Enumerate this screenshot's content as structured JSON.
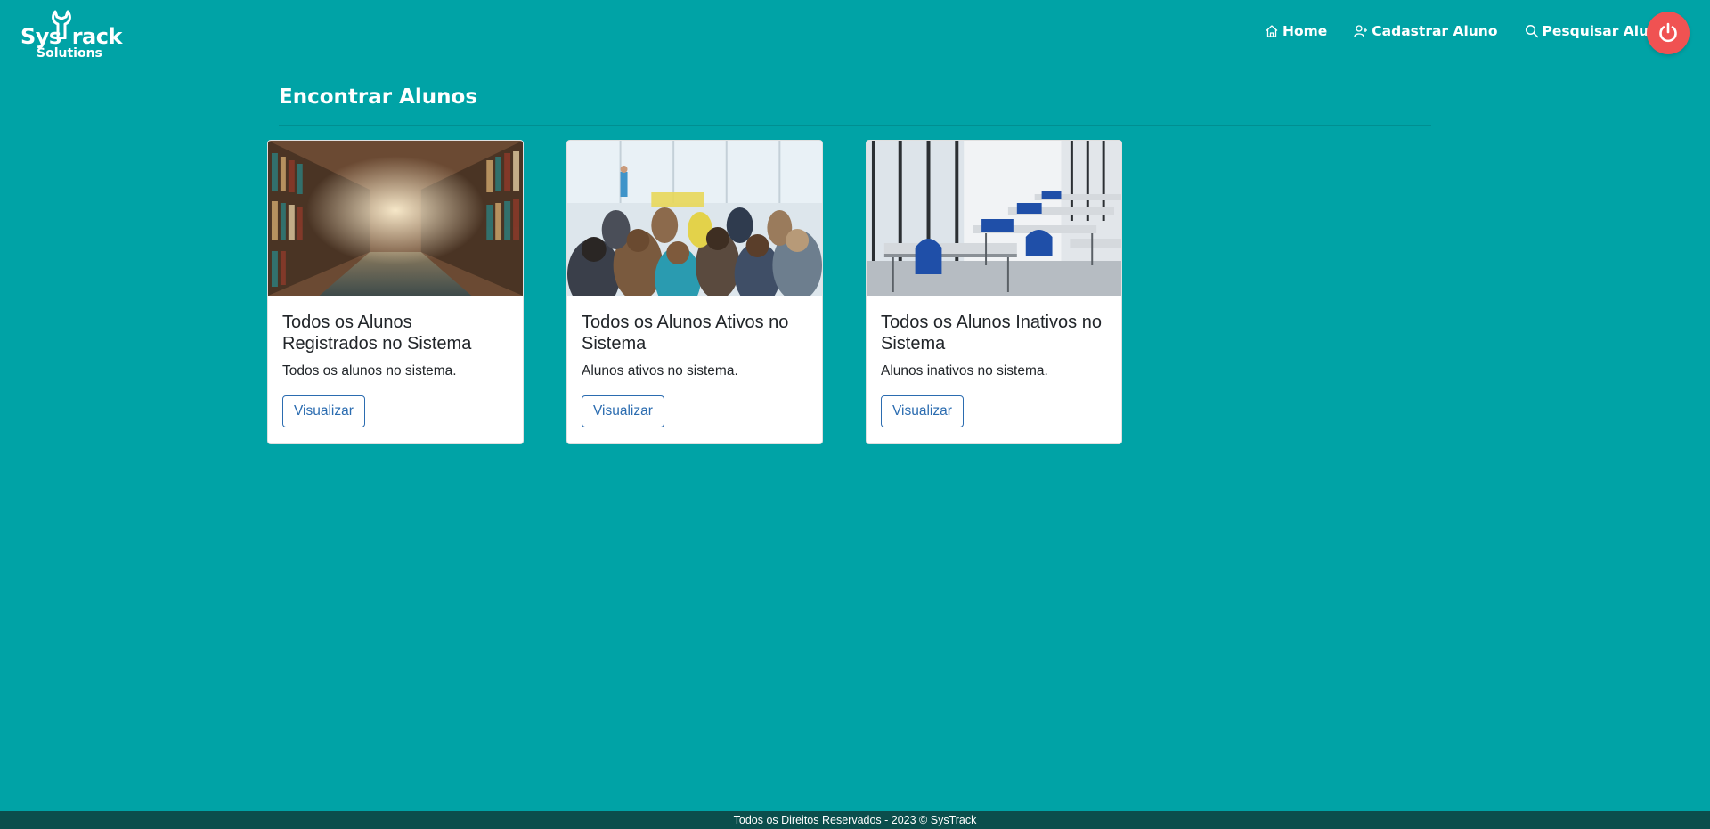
{
  "header": {
    "logo": {
      "main_left": "Sys",
      "main_right": "rack",
      "sub": "Solutions"
    },
    "nav": [
      {
        "label": "Home",
        "icon": "home-icon"
      },
      {
        "label": "Cadastrar Aluno",
        "icon": "user-add-icon"
      },
      {
        "label": "Pesquisar Aluno",
        "icon": "search-icon"
      }
    ],
    "logout_icon": "power-icon"
  },
  "main": {
    "title": "Encontrar Alunos",
    "cards": [
      {
        "image": "library-bookshelves-photo",
        "title": "Todos os Alunos Registrados no Sistema",
        "text": "Todos os alunos no sistema.",
        "button": "Visualizar"
      },
      {
        "image": "classroom-students-photo",
        "title": "Todos os Alunos Ativos no Sistema",
        "text": "Alunos ativos no sistema.",
        "button": "Visualizar"
      },
      {
        "image": "empty-classroom-photo",
        "title": "Todos os Alunos Inativos no Sistema",
        "text": "Alunos inativos no sistema.",
        "button": "Visualizar"
      }
    ]
  },
  "footer": {
    "text": "Todos os Direitos Reservados - 2023 © SysTrack"
  },
  "colors": {
    "background": "#00A3A6",
    "footer": "#0B4E4C",
    "logout": "#F05252",
    "button_outline": "#2B6CB0"
  }
}
